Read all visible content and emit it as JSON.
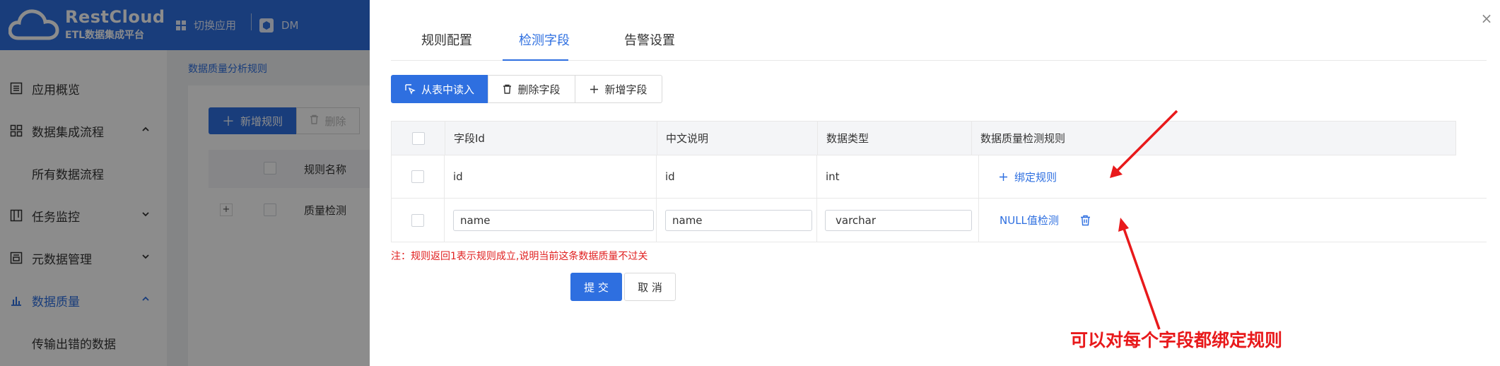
{
  "app": {
    "logo_title": "RestCloud",
    "logo_subtitle": "ETL数据集成平台",
    "switch_app": "切换应用",
    "workspace": "DM"
  },
  "sidebar": {
    "items": [
      {
        "label": "应用概览"
      },
      {
        "label": "数据集成流程"
      },
      {
        "label": "所有数据流程"
      },
      {
        "label": "任务监控"
      },
      {
        "label": "元数据管理"
      },
      {
        "label": "数据质量"
      },
      {
        "label": "传输出错的数据"
      }
    ]
  },
  "background": {
    "breadcrumb": "数据质量分析规则",
    "add_rule": "新增规则",
    "delete": "删除",
    "col_rule_name": "规则名称",
    "row_rule_name": "质量检测",
    "expand": "+"
  },
  "drawer": {
    "close": "×",
    "tabs": [
      "规则配置",
      "检测字段",
      "告警设置"
    ],
    "active_tab": "检测字段",
    "toolbar": {
      "read_from_table": "从表中读入",
      "delete_field": "删除字段",
      "add_field": "新增字段"
    },
    "table": {
      "headers": [
        "字段Id",
        "中文说明",
        "数据类型",
        "数据质量检测规则"
      ],
      "rows": [
        {
          "field_id": "id",
          "desc": "id",
          "type": "int",
          "rule": "绑定规则"
        },
        {
          "field_id": "name",
          "desc": "name",
          "type": "varchar",
          "rule": "NULL值检测"
        }
      ]
    },
    "note": "注：规则返回1表示规则成立,说明当前这条数据质量不过关",
    "submit": "提 交",
    "cancel": "取 消"
  },
  "annotation": "可以对每个字段都绑定规则",
  "colors": {
    "primary": "#2e6fe0",
    "annotation_red": "#e8191b",
    "note_red": "#e02020"
  }
}
